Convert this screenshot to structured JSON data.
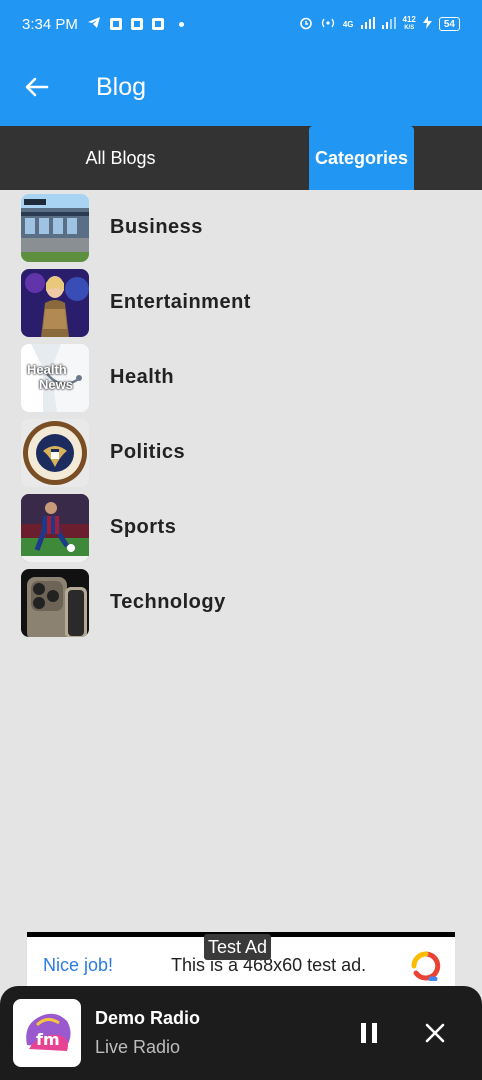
{
  "status_bar": {
    "time": "3:34 PM",
    "network_speed_top": "412",
    "network_speed_unit": "K/S",
    "network_type": "4G",
    "battery": "54"
  },
  "app_bar": {
    "title": "Blog"
  },
  "tabs": [
    {
      "label": "All Blogs",
      "active": false
    },
    {
      "label": "Categories",
      "active": true
    }
  ],
  "categories": [
    {
      "label": "Business",
      "icon": "business-thumbnail"
    },
    {
      "label": "Entertainment",
      "icon": "entertainment-thumbnail"
    },
    {
      "label": "Health",
      "icon": "health-thumbnail",
      "thumb_text": [
        "Health",
        "News"
      ]
    },
    {
      "label": "Politics",
      "icon": "politics-thumbnail"
    },
    {
      "label": "Sports",
      "icon": "sports-thumbnail"
    },
    {
      "label": "Technology",
      "icon": "technology-thumbnail"
    }
  ],
  "ad": {
    "badge": "Test Ad",
    "nice": "Nice job!",
    "text": "This is a 468x60 test ad."
  },
  "player": {
    "title": "Demo Radio",
    "subtitle": "Live Radio",
    "logo_text": "fm"
  },
  "colors": {
    "primary": "#2196f3",
    "tab_bar": "#333333",
    "background": "#e4e4e4",
    "player_bg": "#1c1c1c"
  }
}
